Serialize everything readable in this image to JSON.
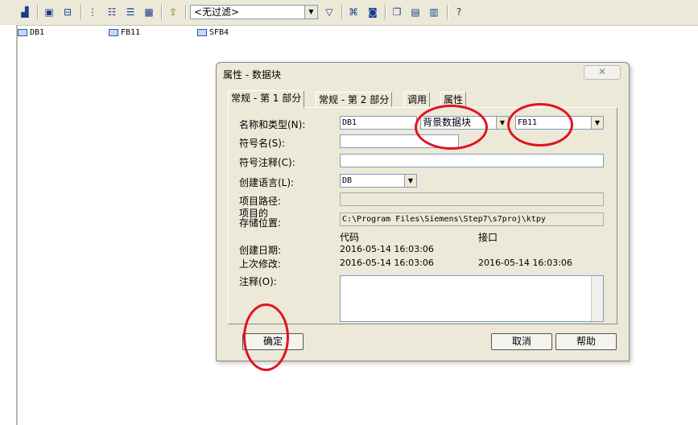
{
  "toolbar": {
    "filter_value": "<无过滤>",
    "icons": [
      "network-icon",
      "module-icon",
      "tree-icon",
      "list-icon",
      "details-icon",
      "large-icons-icon",
      "navigate-up-icon",
      "filter-icon",
      "accessible-nodes-icon",
      "simulation-icon",
      "window-cascade-icon",
      "window-tile-h-icon",
      "window-tile-v-icon",
      "help-icon"
    ]
  },
  "objects": [
    {
      "name": "DB1"
    },
    {
      "name": "FB11"
    },
    {
      "name": "SFB4"
    }
  ],
  "dialog": {
    "title": "属性 - 数据块",
    "close_label": "✕",
    "tabs": [
      {
        "label": "常规 - 第 1 部分"
      },
      {
        "label": "常规 - 第 2 部分"
      },
      {
        "label": "调用"
      },
      {
        "label": "属性"
      }
    ],
    "fields": {
      "name_type_label": "名称和类型(N):",
      "name_value": "DB1",
      "type_value": "背景数据块",
      "fb_value": "FB11",
      "symbol_name_label": "符号名(S):",
      "symbol_name_value": "",
      "symbol_comment_label": "符号注释(C):",
      "symbol_comment_value": "",
      "language_label": "创建语言(L):",
      "language_value": "DB",
      "project_path_label": "项目路径:",
      "project_path_value": "",
      "storage_label_1": "项目的",
      "storage_label_2": "存储位置:",
      "storage_value": "C:\\Program Files\\Siemens\\Step7\\s7proj\\ktpy",
      "code_header": "代码",
      "interface_header": "接口",
      "created_label": "创建日期:",
      "created_code": "2016-05-14 16:03:06",
      "modified_label": "上次修改:",
      "modified_code": "2016-05-14 16:03:06",
      "modified_interface": "2016-05-14 16:03:06",
      "comment_label": "注释(O):",
      "comment_value": ""
    },
    "buttons": {
      "ok": "确定",
      "cancel": "取消",
      "help": "帮助"
    }
  },
  "colors": {
    "annotation": "#e0141e",
    "dialog_bg": "#ece9d8"
  }
}
